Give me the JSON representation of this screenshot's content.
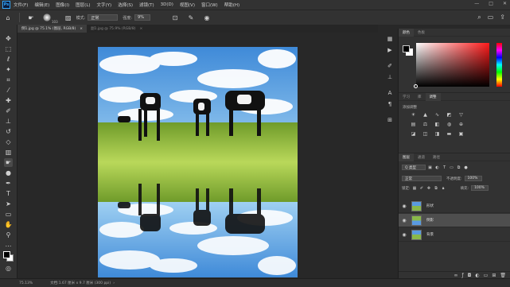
{
  "menubar": {
    "logo": "Ps",
    "items": [
      "文件(F)",
      "编辑(E)",
      "图像(I)",
      "图层(L)",
      "文字(Y)",
      "选择(S)",
      "滤镜(T)",
      "3D(D)",
      "视图(V)",
      "窗口(W)",
      "帮助(H)"
    ],
    "window_controls": [
      "—",
      "□",
      "✕"
    ]
  },
  "options": {
    "brush_size": "103",
    "mode_label": "模式:",
    "mode_value": "正常",
    "strength_label": "强度:",
    "strength_value": "9%"
  },
  "tabs": [
    {
      "label": "倒1.jpg @ 75.1% (图层, RGB/8)",
      "close": "×"
    },
    {
      "label": "副1.jpg @ 75.9% (RGB/8)",
      "close": "×"
    }
  ],
  "status": {
    "zoom": "75.13%",
    "doc_info": "文档:1.67 厘米 x 9.7 厘米 (300 ppi)"
  },
  "panels": {
    "color_tabs": [
      "颜色",
      "色板"
    ],
    "adjust_tabs": [
      "学习",
      "库",
      "调整"
    ],
    "adjust_title": "添加调整",
    "layers_tabs": [
      "图层",
      "通道",
      "路径"
    ],
    "filter_label": "Q 类型",
    "blend_mode": "正常",
    "opacity_label": "不透明度:",
    "opacity_value": "100%",
    "lock_label": "锁定:",
    "fill_label": "填充:",
    "fill_value": "100%",
    "layers": [
      {
        "name": "形状",
        "selected": false
      },
      {
        "name": "倒影",
        "selected": true
      },
      {
        "name": "背景",
        "selected": false
      }
    ]
  },
  "colors": {
    "accent": "#31a8ff",
    "panel": "#323232",
    "canvas_bg": "#282828"
  }
}
